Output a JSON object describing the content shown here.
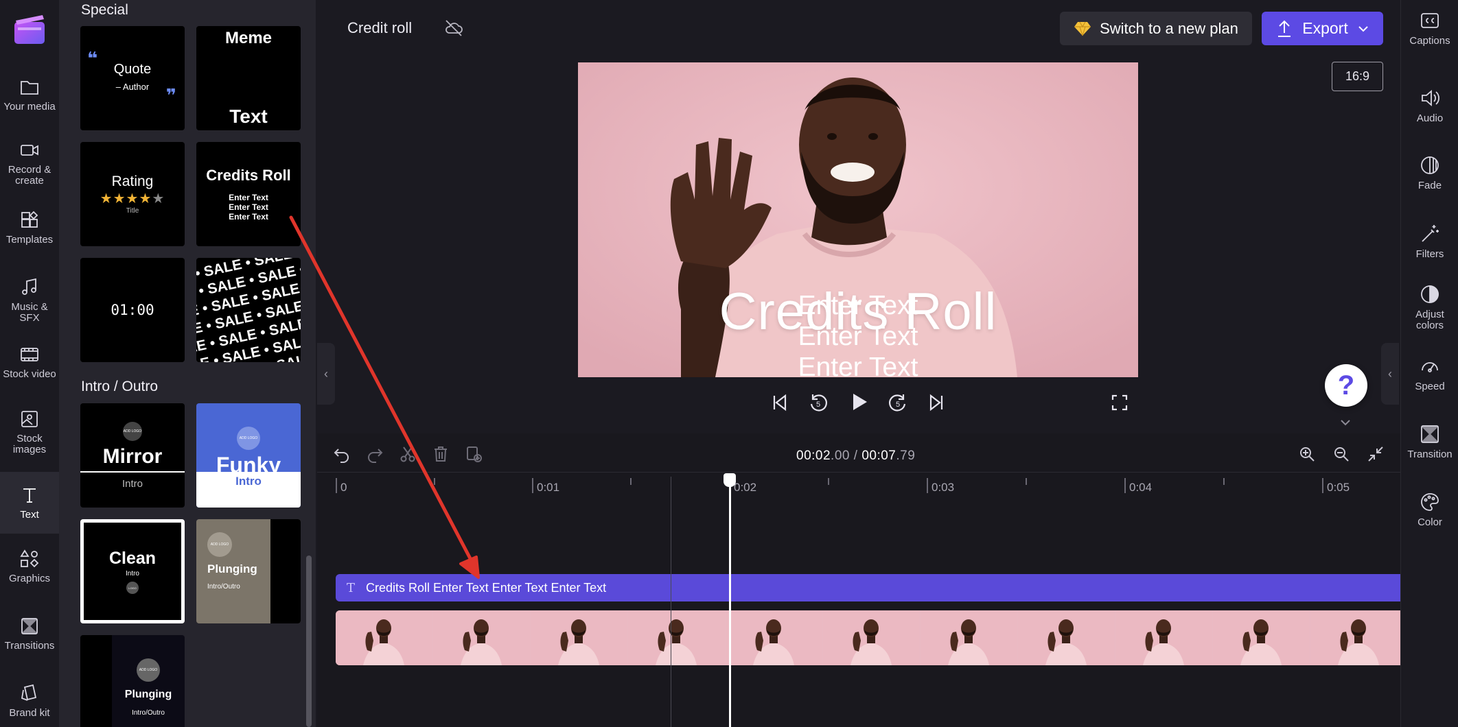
{
  "nav": {
    "items": [
      {
        "label": "Your media",
        "icon": "folder-icon"
      },
      {
        "label": "Record & create",
        "icon": "video-camera-icon"
      },
      {
        "label": "Templates",
        "icon": "templates-icon"
      },
      {
        "label": "Music & SFX",
        "icon": "music-note-icon"
      },
      {
        "label": "Stock video",
        "icon": "film-strip-icon"
      },
      {
        "label": "Stock images",
        "icon": "image-icon"
      },
      {
        "label": "Text",
        "icon": "text-icon",
        "active": true
      },
      {
        "label": "Graphics",
        "icon": "shapes-icon"
      },
      {
        "label": "Transitions",
        "icon": "transitions-icon"
      },
      {
        "label": "Brand kit",
        "icon": "brand-kit-icon"
      }
    ]
  },
  "library": {
    "special_title": "Special",
    "intro_title": "Intro / Outro",
    "special_tiles": {
      "quote": {
        "main": "Quote",
        "sub": "– Author",
        "mark": "❝"
      },
      "meme": {
        "top": "Meme",
        "bottom": "Text"
      },
      "rating": {
        "main": "Rating",
        "stars": "★★★★★",
        "sub": "Title"
      },
      "credits": {
        "main": "Credits Roll",
        "line1": "Enter Text",
        "line2": "Enter Text",
        "line3": "Enter Text"
      },
      "timer": {
        "main": "01:00"
      },
      "sale": {
        "pattern": "LE • SALE • SALE • SALE"
      }
    },
    "intro_tiles": {
      "mirror": {
        "logo": "ADD LOGO",
        "main": "Mirror",
        "sub": "Intro"
      },
      "funky": {
        "logo": "ADD LOGO",
        "main": "Funky",
        "sub": "Intro"
      },
      "clean": {
        "main": "Clean",
        "sub": "Intro",
        "logo": "LOGO"
      },
      "plunging1": {
        "logo": "ADD LOGO",
        "main": "Plunging",
        "sub": "Intro/Outro"
      },
      "plunging2": {
        "logo": "ADD LOGO",
        "main": "Plunging",
        "sub": "Intro/Outro"
      }
    }
  },
  "header": {
    "project_title": "Credit roll",
    "plan_button": "Switch to a new plan",
    "export_button": "Export",
    "aspect_ratio": "16:9"
  },
  "preview": {
    "title": "Credits Roll",
    "lines": [
      "Enter Text",
      "Enter Text",
      "Enter Text"
    ]
  },
  "help": {
    "label": "?"
  },
  "timeline": {
    "time_current_main": "00:02",
    "time_current_frac": ".00",
    "time_separator": " / ",
    "time_total_main": "00:07",
    "time_total_frac": ".79",
    "ruler_labels": [
      "0",
      "0:01",
      "0:02",
      "0:03",
      "0:04",
      "0:05"
    ],
    "text_clip_label": "Credits Roll Enter Text Enter Text Enter Text",
    "text_clip_icon": "T",
    "playhead_seconds": 2.0
  },
  "right_panel": {
    "items": [
      {
        "label": "Captions",
        "icon": "captions-icon"
      },
      {
        "label": "Audio",
        "icon": "speaker-icon"
      },
      {
        "label": "Fade",
        "icon": "fade-icon"
      },
      {
        "label": "Filters",
        "icon": "magic-wand-icon"
      },
      {
        "label": "Adjust colors",
        "icon": "contrast-icon"
      },
      {
        "label": "Speed",
        "icon": "speedometer-icon"
      },
      {
        "label": "Transition",
        "icon": "transition-icon"
      },
      {
        "label": "Color",
        "icon": "palette-icon"
      }
    ]
  },
  "colors": {
    "accent": "#5c4ae4",
    "text_clip": "#5a4ad9",
    "preview_bg": "#e6b4bd",
    "annotation_arrow": "#e0352b"
  }
}
